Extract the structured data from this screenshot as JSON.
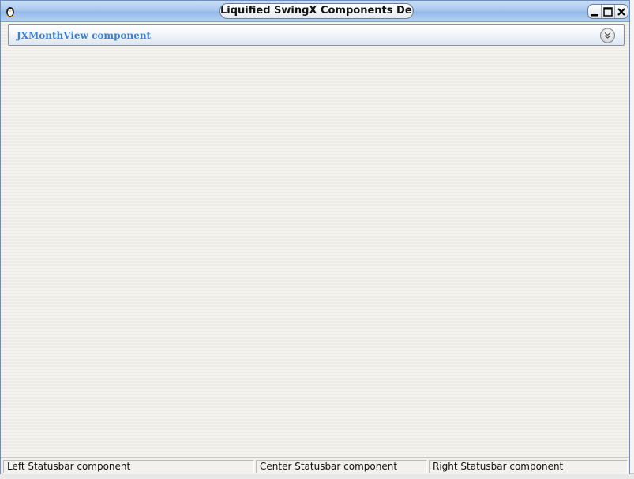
{
  "window": {
    "title": "Liquified SwingX Components Demo",
    "icons": [
      "app-icon",
      "minimize-icon",
      "maximize-icon",
      "close-icon"
    ]
  },
  "taskpane": {
    "title": "JXMonthView component",
    "collapse_icon": "chevron-double-down-icon",
    "title_color": "#3d7fcf"
  },
  "statusbar": {
    "left": "Left Statusbar component",
    "center": "Center Statusbar component",
    "right": "Right Statusbar component"
  }
}
